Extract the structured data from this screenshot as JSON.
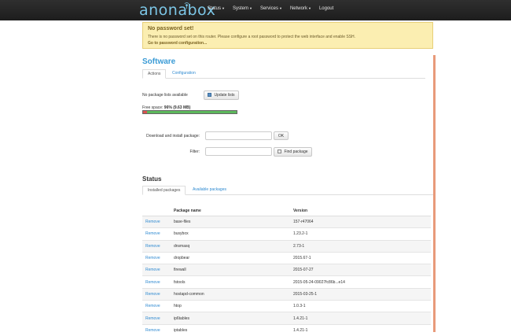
{
  "brand": {
    "logo_text": "anonabox"
  },
  "nav": {
    "items": [
      "Status",
      "System",
      "Services",
      "Network",
      "Logout"
    ]
  },
  "alert": {
    "title": "No password set!",
    "message": "There is no password set on this router. Please configure a root password to protect the web interface and enable SSH.",
    "link": "Go to password configuration..."
  },
  "page": {
    "title": "Software"
  },
  "tabs": [
    {
      "label": "Actions"
    },
    {
      "label": "Configuration"
    }
  ],
  "actions": {
    "status_text": "No package lists available",
    "update_label": "Update lists",
    "free_label": "Free space:",
    "free_value": "96% (9.63 MB)",
    "free_fraction": 0.96,
    "download_label": "Download and install package:",
    "ok_label": "OK",
    "filter_label": "Filter:",
    "find_label": "Find package"
  },
  "status": {
    "title": "Status",
    "tabs": [
      {
        "label": "Installed packages"
      },
      {
        "label": "Available packages"
      }
    ],
    "headers": {
      "name": "Package name",
      "version": "Version"
    },
    "action_label": "Remove",
    "rows": [
      {
        "name": "base-files",
        "version": "157-r47064"
      },
      {
        "name": "busybox",
        "version": "1.23.2-1"
      },
      {
        "name": "dnsmasq",
        "version": "2.73-1"
      },
      {
        "name": "dropbear",
        "version": "2015.67-1"
      },
      {
        "name": "firewall",
        "version": "2015-07-27"
      },
      {
        "name": "fstools",
        "version": "2015-05-24-09027fc86b...e14"
      },
      {
        "name": "hostapd-common",
        "version": "2015-03-25-1"
      },
      {
        "name": "htop",
        "version": "1.0.3-1"
      },
      {
        "name": "ip6tables",
        "version": "1.4.21-1"
      },
      {
        "name": "iptables",
        "version": "1.4.21-1"
      }
    ]
  }
}
